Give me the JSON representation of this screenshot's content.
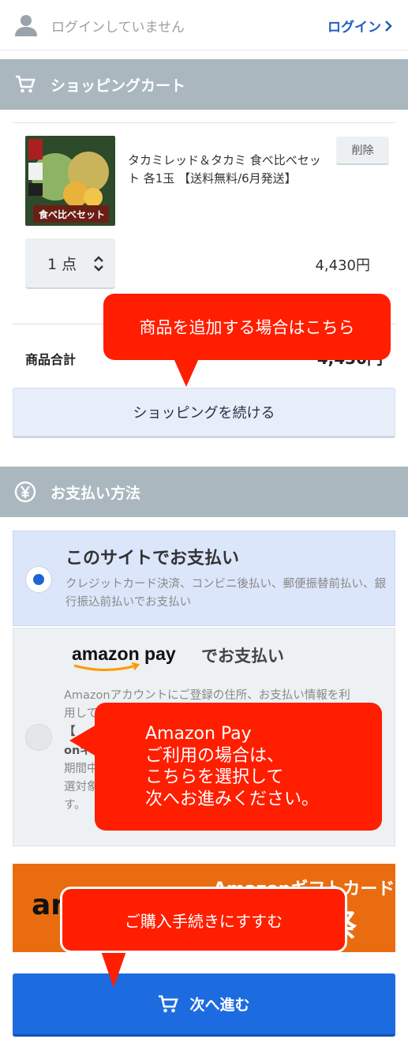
{
  "header": {
    "login_status": "ログインしていません",
    "login_link": "ログイン",
    "user_icon": "user-icon"
  },
  "cart": {
    "section_title": "ショッピングカート",
    "section_icon": "cart-icon",
    "item": {
      "name": "タカミレッド＆タカミ 食べ比べセット 各1玉 【送料無料/6月発送】",
      "delete_label": "削除",
      "quantity": "1 点",
      "price": "4,430円",
      "thumbnail_caption": "食べ比べセット"
    },
    "subtotal_label": "商品合計",
    "subtotal_value": "4,430円",
    "continue_label": "ショッピングを続ける"
  },
  "payment": {
    "section_title": "お支払い方法",
    "section_icon": "yen-icon",
    "site_option": {
      "title": "このサイトでお支払い",
      "description": "クレジットカード決済、コンビニ後払い、郵便振替前払い、銀行振込前払いでお支払い",
      "selected": true
    },
    "amazon_option": {
      "logo_text": "amazon pay",
      "title": "でお支払い",
      "description_lines": [
        "Amazonアカウントにご登録の住所、お支払い情報を利",
        "用して",
        "【",
        "onギ",
        "期間中",
        "選対象",
        "す。"
      ],
      "selected": false
    }
  },
  "banner": {
    "title": "Amazonギフトカード",
    "logo_text": "am",
    "big_text": "祭"
  },
  "next_button": {
    "label": "次へ進む",
    "icon": "cart-icon"
  },
  "callouts": {
    "add_items": "商品を追加する場合はこちら",
    "amazon_pay": "Amazon Pay\nご利用の場合は、\nこちらを選択して\n次へお進みください。",
    "proceed": "ご購入手続きにすすむ"
  },
  "colors": {
    "accent": "#1d6be0",
    "callout": "#ff1e00",
    "section_header": "#aab7bf",
    "selected_option": "#dce6fa"
  }
}
